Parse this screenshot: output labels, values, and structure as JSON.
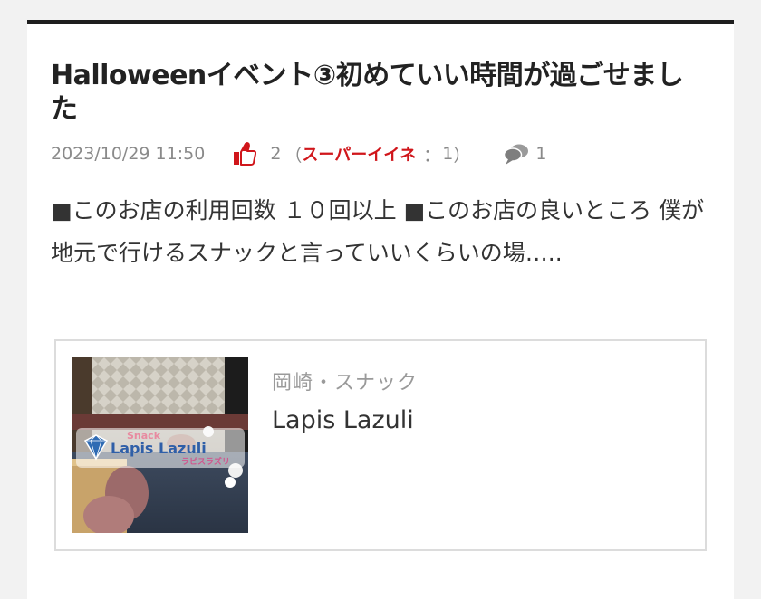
{
  "post": {
    "title": "Halloweenイベント③初めていい時間が過ごせました",
    "date": "2023/10/29 11:50",
    "like_count": "2",
    "paren_open": "（",
    "super_like_label": "スーパーイイネ",
    "super_like_sep": "：",
    "super_like_count": "1",
    "paren_close": "）",
    "comment_count": "1",
    "excerpt": "■このお店の利用回数 １０回以上 ■このお店の良いところ 僕が地元で行けるスナックと言っていいくらいの場….."
  },
  "shop": {
    "category": "岡崎・スナック",
    "name": "Lapis Lazuli",
    "logo_small": "Snack",
    "logo_main": "Lapis Lazuli",
    "logo_kana": "ラピスラズリ"
  },
  "colors": {
    "accent_red": "#d0161b",
    "top_border": "#1e1e1e",
    "meta_gray": "#8a8a8a"
  },
  "icons": {
    "like": "thumbs-up-icon",
    "comment": "speech-bubble-icon"
  }
}
